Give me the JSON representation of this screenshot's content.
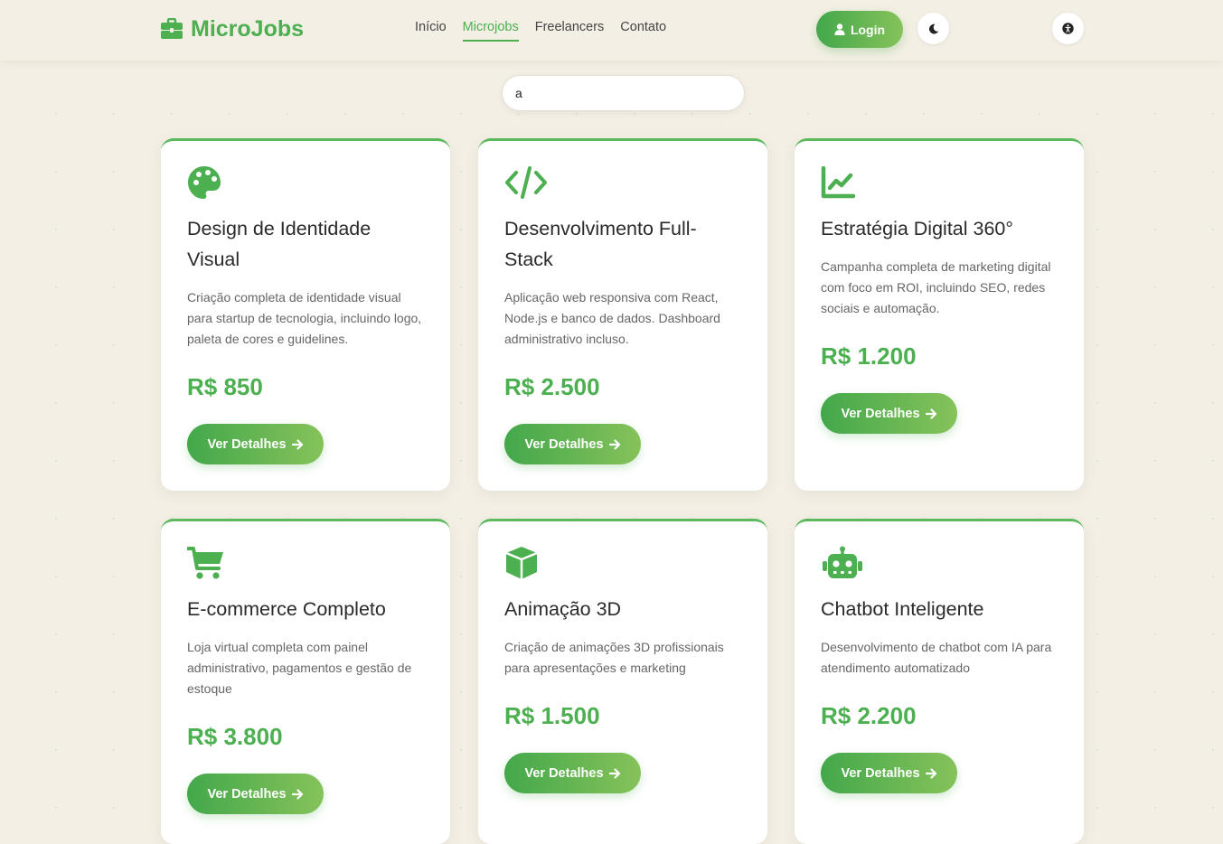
{
  "brand": {
    "name": "MicroJobs",
    "icon": "briefcase-icon",
    "color": "#4caf50"
  },
  "nav": {
    "items": [
      {
        "label": "Início",
        "active": false
      },
      {
        "label": "Microjobs",
        "active": true
      },
      {
        "label": "Freelancers",
        "active": false
      },
      {
        "label": "Contato",
        "active": false
      }
    ]
  },
  "header": {
    "login_label": "Login",
    "login_icon": "user-icon",
    "theme_icon": "moon-icon",
    "accessibility_icon": "accessibility-icon"
  },
  "search": {
    "value": "a",
    "placeholder": ""
  },
  "cards": [
    {
      "icon": "palette-icon",
      "title": "Design de Identidade Visual",
      "description": "Criação completa de identidade visual para startup de tecnologia, incluindo logo, paleta de cores e guidelines.",
      "price": "R$ 850",
      "button": "Ver Detalhes"
    },
    {
      "icon": "code-icon",
      "title": "Desenvolvimento Full-Stack",
      "description": "Aplicação web responsiva com React, Node.js e banco de dados. Dashboard administrativo incluso.",
      "price": "R$ 2.500",
      "button": "Ver Detalhes"
    },
    {
      "icon": "chart-line-icon",
      "title": "Estratégia Digital 360°",
      "description": "Campanha completa de marketing digital com foco em ROI, incluindo SEO, redes sociais e automação.",
      "price": "R$ 1.200",
      "button": "Ver Detalhes"
    },
    {
      "icon": "shopping-cart-icon",
      "title": "E-commerce Completo",
      "description": "Loja virtual completa com painel administrativo, pagamentos e gestão de estoque",
      "price": "R$ 3.800",
      "button": "Ver Detalhes"
    },
    {
      "icon": "cube-icon",
      "title": "Animação 3D",
      "description": "Criação de animações 3D profissionais para apresentações e marketing",
      "price": "R$ 1.500",
      "button": "Ver Detalhes"
    },
    {
      "icon": "robot-icon",
      "title": "Chatbot Inteligente",
      "description": "Desenvolvimento de chatbot com IA para atendimento automatizado",
      "price": "R$ 2.200",
      "button": "Ver Detalhes"
    }
  ]
}
